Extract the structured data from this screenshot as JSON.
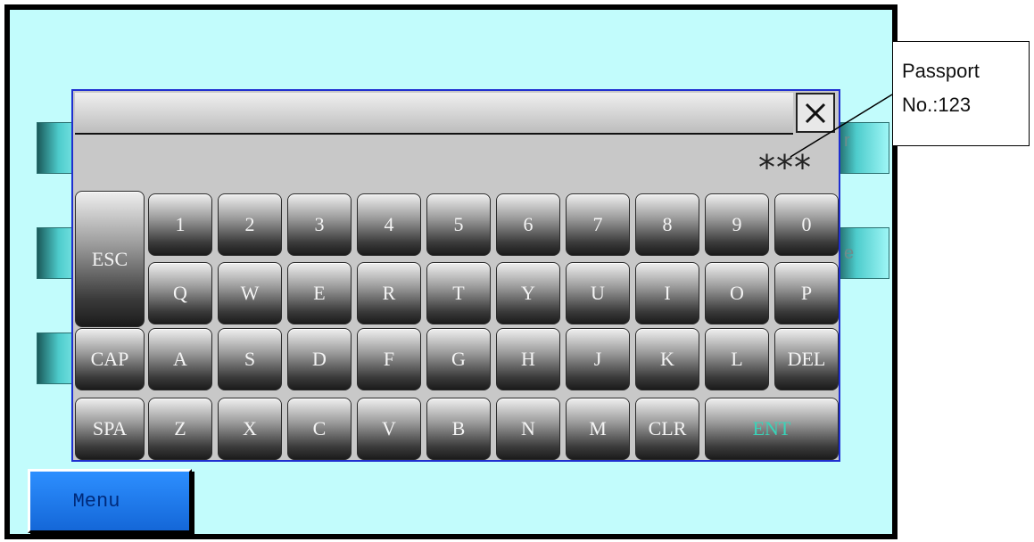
{
  "menu": {
    "label": "Menu"
  },
  "keyboard": {
    "display_value": "***",
    "close_icon": "close-icon",
    "rows": [
      [
        "1",
        "2",
        "3",
        "4",
        "5",
        "6",
        "7",
        "8",
        "9",
        "0"
      ],
      [
        "Q",
        "W",
        "E",
        "R",
        "T",
        "Y",
        "U",
        "I",
        "O",
        "P"
      ],
      [
        "CAP",
        "A",
        "S",
        "D",
        "F",
        "G",
        "H",
        "J",
        "K",
        "L",
        "DEL"
      ],
      [
        "SPA",
        "Z",
        "X",
        "C",
        "V",
        "B",
        "N",
        "M",
        "CLR",
        "ENT"
      ]
    ],
    "esc_label": "ESC"
  },
  "background": {
    "partial_text_1": "r",
    "partial_text_2": "e"
  },
  "callout": {
    "line1": "Passport",
    "line2": "No.:123"
  },
  "colors": {
    "screen_bg": "#c2fcfc",
    "keyboard_border": "#1f2fd0",
    "menu_bg": "#1e7cf0",
    "ent_text": "#39d3b8"
  }
}
